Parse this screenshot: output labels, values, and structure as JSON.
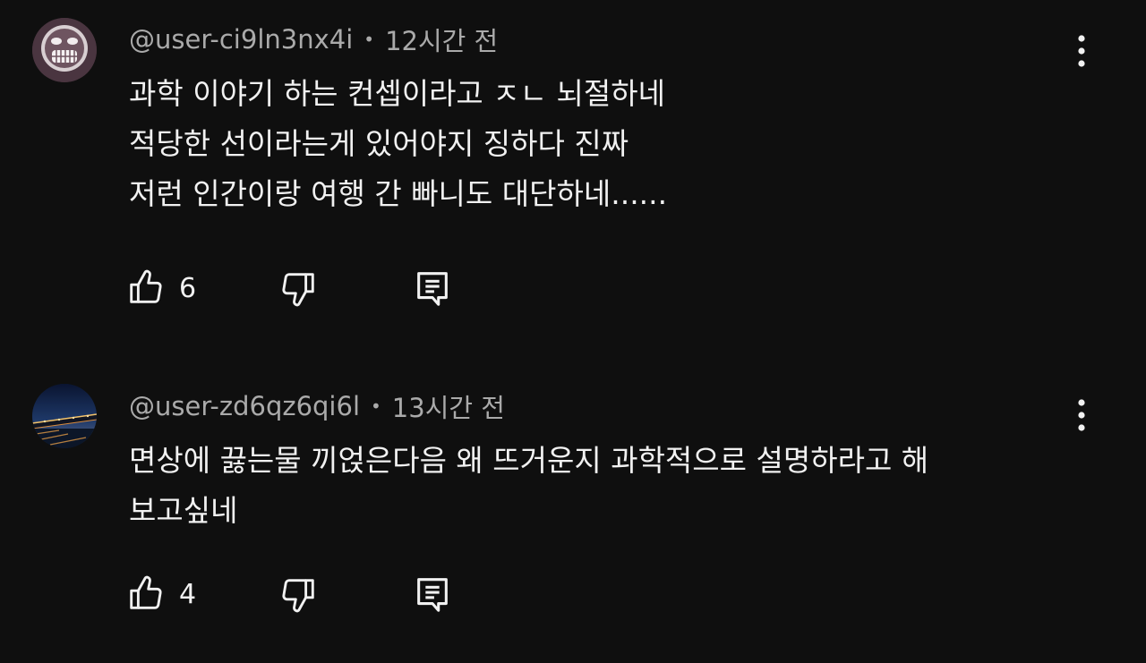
{
  "comments": [
    {
      "author": "@user-ci9ln3nx4i",
      "time": "12시간 전",
      "lines": [
        "과학 이야기 하는 컨셉이라고 ㅈㄴ 뇌절하네",
        "적당한 선이라는게 있어야지 징하다 진짜",
        "저런 인간이랑 여행 간 빠니도 대단하네......"
      ],
      "likes": "6"
    },
    {
      "author": "@user-zd6qz6qi6l",
      "time": "13시간 전",
      "lines": [
        "면상에 끓는물 끼얹은다음 왜 뜨거운지 과학적으로 설명하라고 해",
        "보고싶네"
      ],
      "likes": "4"
    }
  ],
  "separator": "•",
  "colors": {
    "background": "#0f0f0f",
    "text": "#f1f1f1",
    "meta": "#aaaaaa"
  },
  "icons": {
    "like": "thumb-up-icon",
    "dislike": "thumb-down-icon",
    "reply": "comment-icon",
    "menu": "more-vertical-icon"
  }
}
